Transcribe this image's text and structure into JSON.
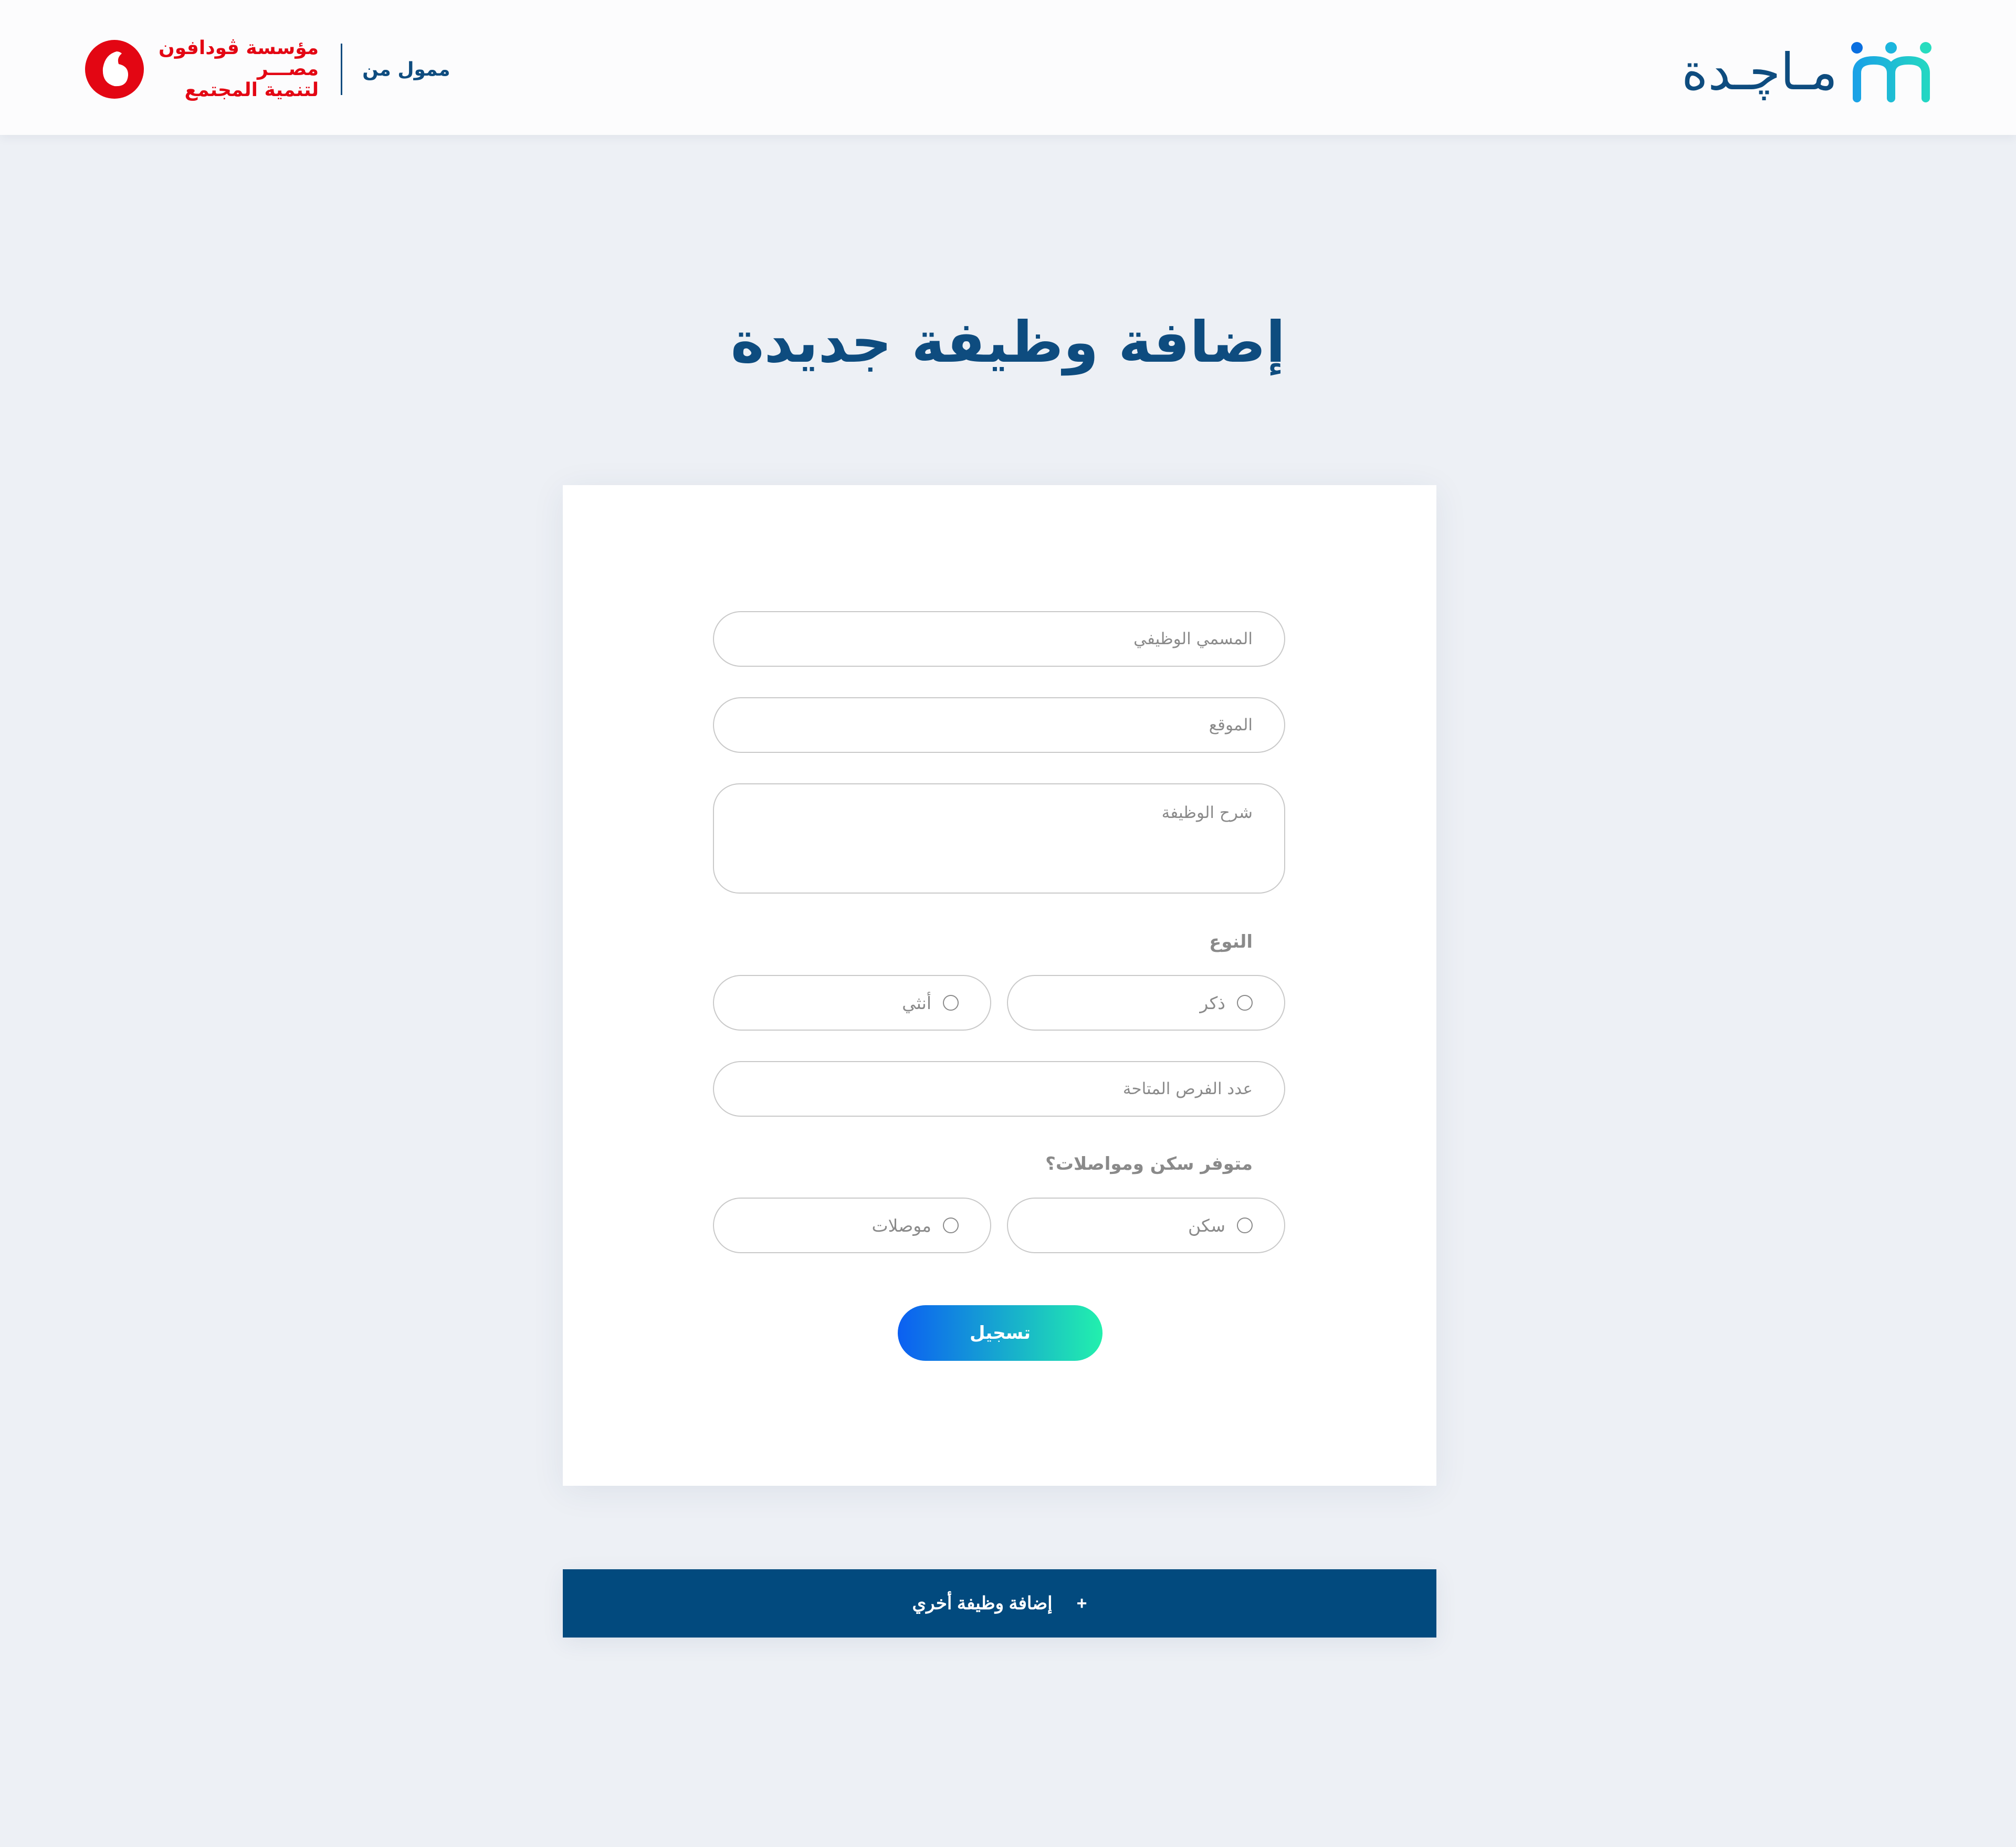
{
  "header": {
    "brand_name": "مـاچـدة",
    "funded_by": "ممول من",
    "sponsor_line1": "مؤسسة ڤودافون",
    "sponsor_line2": "مصـــر",
    "sponsor_line3": "لتنمية المجتمع",
    "sponsor_color": "#e30613",
    "brand_color": "#0e4c7f"
  },
  "page": {
    "title": "إضافة وظيفة جديدة"
  },
  "form": {
    "job_title_placeholder": "المسمي الوظيفي",
    "location_placeholder": "الموقع",
    "description_placeholder": "شرح الوظيفة",
    "gender_label": "النوع",
    "gender_options": [
      "ذكر",
      "أنثي"
    ],
    "openings_placeholder": "عدد الفرص المتاحة",
    "benefits_label": "متوفر سكن ومواصلات؟",
    "benefits_options": [
      "سكن",
      "موصلات"
    ],
    "submit_label": "تسجيل",
    "submit_gradient": [
      "#0b5ff2",
      "#22f0ad"
    ]
  },
  "footer_action": {
    "plus": "+",
    "label": "إضافة وظيفة أخري",
    "color": "#024a7e"
  },
  "icons": {
    "brand": "majeda-logo-icon",
    "sponsor": "vodafone-logo-icon",
    "radio": "radio-unchecked-icon"
  }
}
